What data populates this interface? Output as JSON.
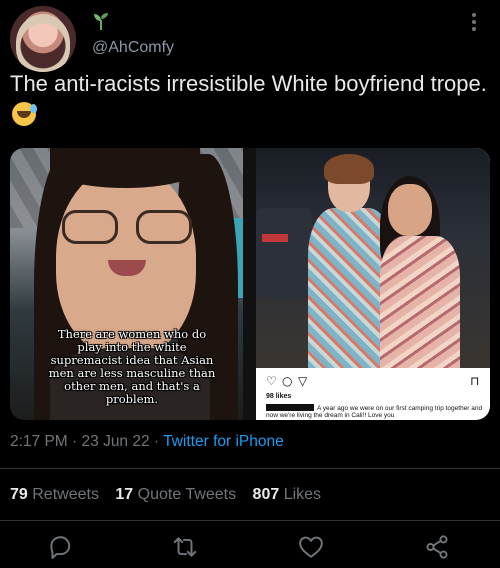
{
  "tweet": {
    "handle": "@AhComfy",
    "text": "The anti-racists irresistible White boyfriend trope.",
    "emoji": "sweat-smile-emoji",
    "time": "2:17 PM",
    "date": "23 Jun 22",
    "source": "Twitter for iPhone"
  },
  "media": {
    "left_caption": "There are women who do play into the white supremacist idea that Asian men are less masculine than other men, and that's a problem.",
    "right_likes": "98 likes",
    "right_caption": "A year ago we were on our first camping trip together and now we're living the dream in Cali!! Love you"
  },
  "stats": {
    "retweets_count": "79",
    "retweets_label": "Retweets",
    "quotes_count": "17",
    "quotes_label": "Quote Tweets",
    "likes_count": "807",
    "likes_label": "Likes"
  },
  "icons": {
    "reply": "reply-icon",
    "retweet": "retweet-icon",
    "like": "heart-icon",
    "share": "share-icon",
    "more": "more-icon",
    "badge": "sprout-icon"
  },
  "colors": {
    "background": "#000000",
    "text": "#e7e9ea",
    "muted": "#71767b",
    "link": "#1d9bf0"
  }
}
